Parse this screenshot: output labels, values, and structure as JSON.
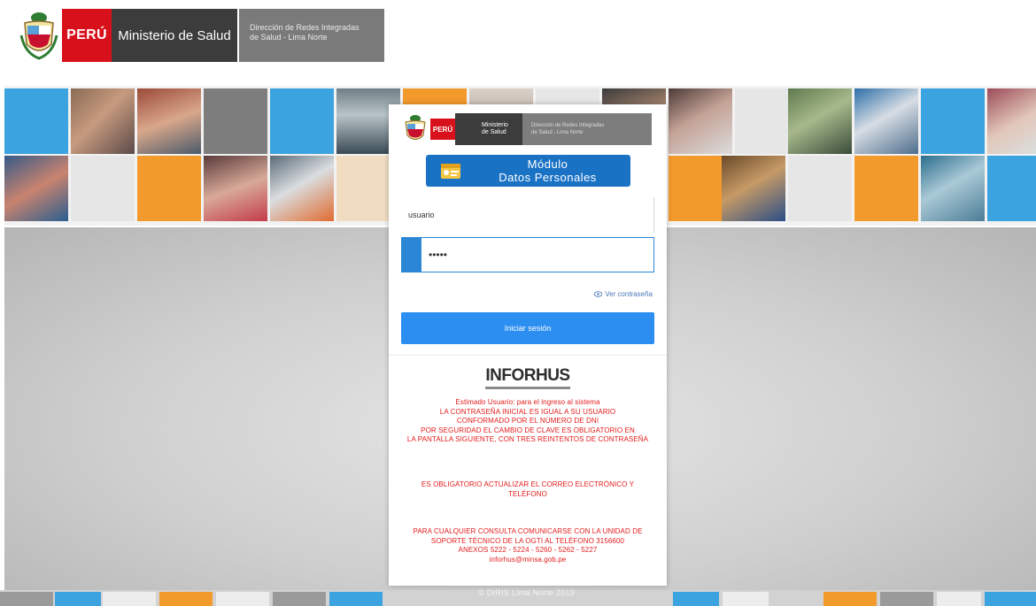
{
  "header": {
    "peru_label": "PERÚ",
    "ministry_label": "Ministerio de Salud",
    "directorate_line1": "Dirección de Redes Integradas",
    "directorate_line2": "de Salud - Lima Norte"
  },
  "card": {
    "logo": {
      "peru_label": "PERÚ",
      "ministry_line1": "Ministerio",
      "ministry_line2": "de Salud"
    },
    "module": {
      "line1": "Módulo",
      "line2": "Datos Personales"
    },
    "username": {
      "value": "usuario"
    },
    "password": {
      "value": "•••••"
    },
    "show_password_label": "Ver contraseña",
    "login_label": "Iniciar sesión",
    "brand_logo_text": "INFORHUS",
    "notice_1": [
      "Estimado Usuario: para el ingreso al sistema",
      "LA CONTRASEÑA INICIAL ES IGUAL A SU USUARIO",
      "CONFORMADO POR EL NÚMERO DE DNI",
      "POR SEGURIDAD EL CAMBIO DE CLAVE ES OBLIGATORIO EN",
      "LA PANTALLA SIGUIENTE, CON TRES REINTENTOS DE CONTRASEÑA"
    ],
    "notice_2": [
      "ES OBLIGATORIO ACTUALIZAR EL CORREO ELECTRÓNICO Y",
      "TELÉFONO"
    ],
    "notice_3": [
      "PARA CUALQUIER CONSULTA COMUNICARSE CON LA UNIDAD DE",
      "SOPORTE TÉCNICO DE LA OGTI AL TELÉFONO 3156600",
      "ANEXOS 5222 - 5224 - 5260 - 5262 - 5227",
      "inforhus@minsa.gob.pe"
    ]
  },
  "footer": {
    "copyright": "© DIRIS Lima Norte 2019"
  },
  "colors": {
    "brand_red": "#d8101c",
    "primary_blue": "#2b8ef0",
    "module_blue": "#1a72c4",
    "notice_red": "#e41b1b",
    "tile_orange": "#f39a2c",
    "tile_blue": "#3aa3e0"
  }
}
